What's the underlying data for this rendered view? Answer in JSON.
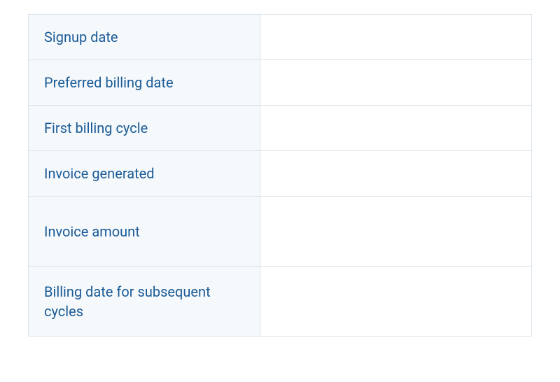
{
  "rows": [
    {
      "label": "Signup date",
      "value": ""
    },
    {
      "label": "Preferred billing date",
      "value": ""
    },
    {
      "label": "First billing cycle",
      "value": ""
    },
    {
      "label": "Invoice generated",
      "value": ""
    },
    {
      "label": "Invoice amount",
      "value": ""
    },
    {
      "label": "Billing date for subsequent cycles",
      "value": ""
    }
  ]
}
